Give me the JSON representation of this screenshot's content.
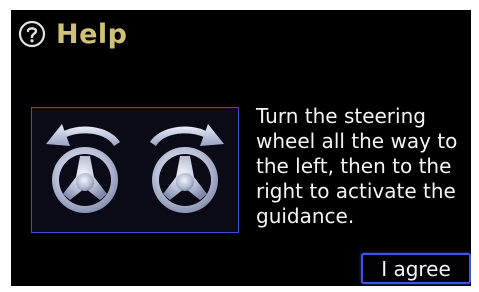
{
  "header": {
    "icon": "question-circle-icon",
    "title": "Help"
  },
  "illustration": {
    "icons": [
      "rotate-left-arrow-icon",
      "steering-wheel-icon",
      "rotate-right-arrow-icon",
      "steering-wheel-icon"
    ]
  },
  "message": "Turn the steering\nwheel all the way to\nthe left, then to the\nright to activate the\nguidance.",
  "agree_button": {
    "label": "I agree"
  },
  "colors": {
    "background": "#000000",
    "title": "#cfc07a",
    "accent_blue": "#3f54ef",
    "text": "#f4f4f4"
  }
}
